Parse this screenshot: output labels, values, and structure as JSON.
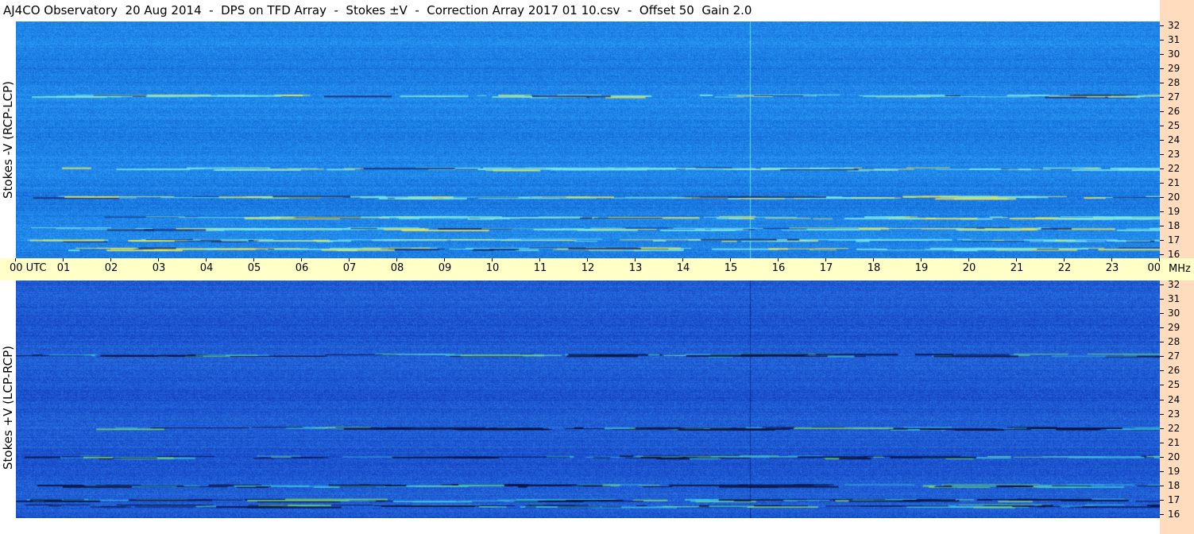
{
  "title": "AJ4CO Observatory  20 Aug 2014  -  DPS on TFD Array  -  Stokes ±V  -  Correction Array 2017 01 10.csv  -  Offset 50  Gain 2.0",
  "chart_data": {
    "type": "heatmap",
    "time_axis": {
      "labels": [
        "00 UTC",
        "01",
        "02",
        "03",
        "04",
        "05",
        "06",
        "07",
        "08",
        "09",
        "10",
        "11",
        "12",
        "13",
        "14",
        "15",
        "16",
        "17",
        "18",
        "19",
        "20",
        "21",
        "22",
        "23",
        "00"
      ],
      "range_hours": [
        0,
        24
      ]
    },
    "freq_axis": {
      "unit": "MHz",
      "range": [
        16,
        32
      ],
      "ticks": [
        32,
        31,
        30,
        29,
        28,
        27,
        26,
        25,
        24,
        23,
        22,
        21,
        20,
        19,
        18,
        17,
        16
      ]
    },
    "panels": [
      {
        "name": "Stokes -V (RCP-LCP)",
        "base_color": "#1e82e6",
        "interference_bands_mhz": [
          27.1,
          22.0,
          20.0,
          18.6,
          17.8,
          17.0,
          16.4
        ],
        "vertical_line_utc": 15.4
      },
      {
        "name": "Stokes +V (LCP-RCP)",
        "base_color": "#1e5ad2",
        "interference_bands_mhz": [
          27.1,
          22.0,
          20.0,
          18.0,
          17.0,
          16.6
        ],
        "vertical_line_utc": 15.4
      }
    ]
  }
}
